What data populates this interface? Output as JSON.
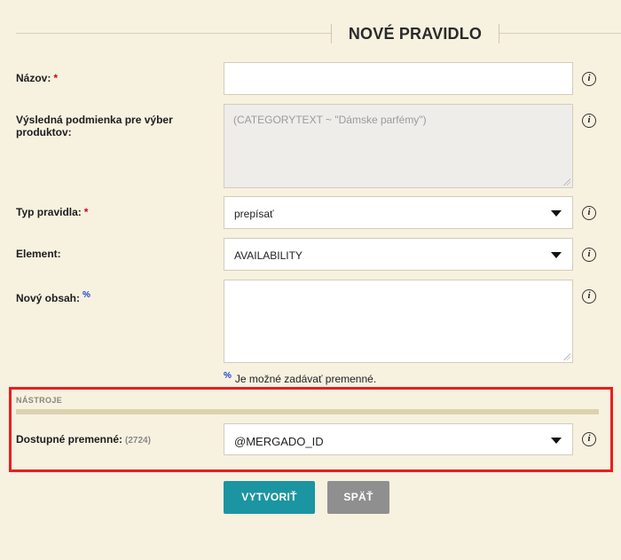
{
  "header": {
    "title": "NOVÉ PRAVIDLO"
  },
  "form": {
    "name": {
      "label": "Názov:",
      "required_mark": "*",
      "value": ""
    },
    "condition": {
      "label": "Výsledná podmienka pre výber produktov:",
      "placeholder": "(CATEGORYTEXT ~ \"Dámske parfémy\")"
    },
    "rule_type": {
      "label": "Typ pravidla:",
      "required_mark": "*",
      "selected": "prepísať"
    },
    "element": {
      "label": "Element:",
      "selected": "AVAILABILITY"
    },
    "new_content": {
      "label": "Nový obsah:",
      "variable_mark": "%",
      "value": ""
    },
    "hint": {
      "mark": "%",
      "text": "Je možné zadávať premenné."
    }
  },
  "tools": {
    "section_title": "NÁSTROJE",
    "variables": {
      "label": "Dostupné premenné:",
      "count": "(2724)",
      "selected": "@MERGADO_ID"
    }
  },
  "buttons": {
    "create": "VYTVORIŤ",
    "back": "SPÄŤ"
  },
  "info_icon_glyph": "i",
  "colors": {
    "background": "#f7f1e0",
    "primary": "#1b95a1",
    "secondary": "#8f8f8f",
    "highlight": "#ee1c1c",
    "required": "#d0021b"
  }
}
